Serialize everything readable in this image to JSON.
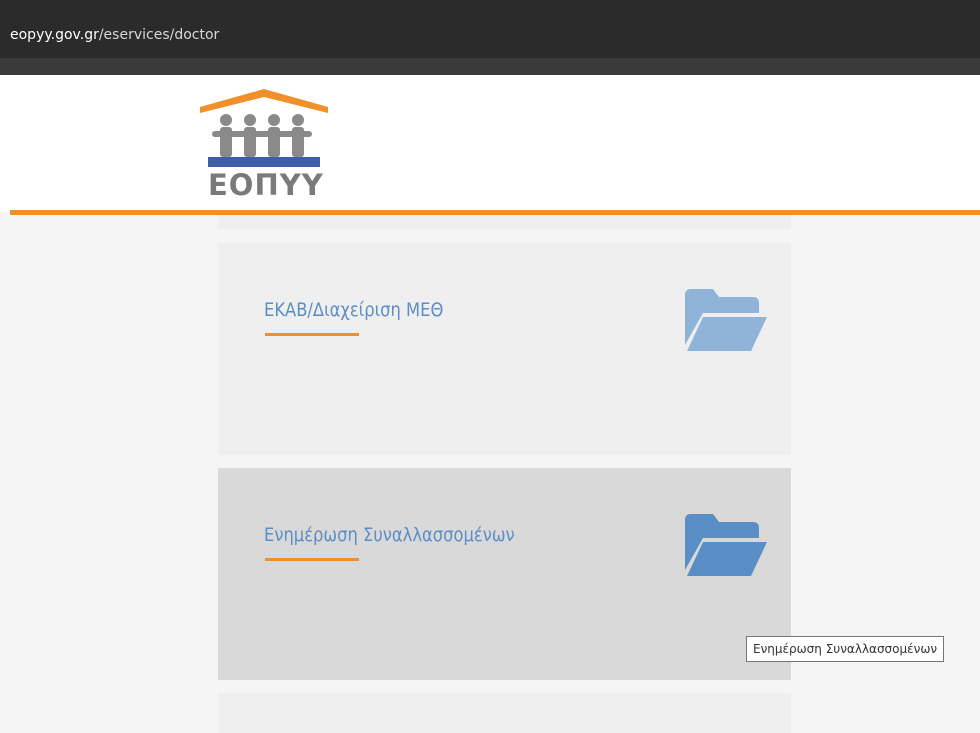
{
  "browser": {
    "url_host": "eopyy.gov.gr",
    "url_path": "/eservices/doctor"
  },
  "header": {
    "logo_text": "ΕΟΠΥΥ",
    "accent_color": "#f0902a"
  },
  "cards": [
    {
      "title": "ΕΚΑΒ/Διαχείριση ΜΕΘ",
      "icon": "folder-open-icon",
      "state": "normal"
    },
    {
      "title": "Ενημέρωση Συναλλασσομένων",
      "icon": "folder-open-icon",
      "state": "hover"
    }
  ],
  "tooltip": {
    "text": "Ενημέρωση Συναλλασσομένων"
  },
  "colors": {
    "card_bg": "#efefef",
    "card_hover_bg": "#d9d9d9",
    "title_color": "#5a8ec6",
    "folder_light": "#8fb3d9",
    "folder_dark": "#5a8ec6"
  }
}
